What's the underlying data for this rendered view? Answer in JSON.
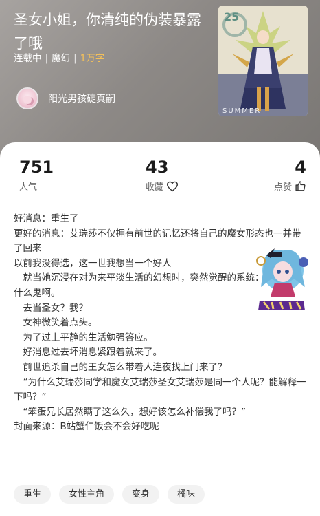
{
  "book": {
    "title": "圣女小姐，你清纯的伪装暴露了哦",
    "status": "连载中",
    "genre": "魔幻",
    "word_count": "1万字",
    "author": "阳光男孩碇真嗣"
  },
  "stats": {
    "popularity": {
      "value": "751",
      "label": "人气"
    },
    "favorites": {
      "value": "43",
      "label": "收藏"
    },
    "likes": {
      "value": "4",
      "label": "点赞"
    }
  },
  "synopsis": {
    "lines": [
      "好消息：重生了",
      "更好的消息：艾瑞莎不仅拥有前世的记忆还将自己的魔女形态也一并带了回来",
      "以前我没得选，这一世我想当一个好人",
      "就当她沉浸在对为来平淡生活的幻想时，突然觉醒的系统：",
      "什么鬼啊。",
      "去当圣女？我？",
      "女神微笑着点头。",
      "为了过上平静的生活勉强答应。",
      "好消息过去坏消息紧跟着就来了。",
      "前世追杀自己的王女怎么带着人连夜找上门来了？",
      "“为什么艾瑞莎同学和魔女艾瑞莎圣女艾瑞莎是同一个人呢？能解释一下吗？”",
      "“笨蛋兄长居然瞒了这么久，想好该怎么补偿我了吗？”",
      "封面来源：B站蟹仁饭会不会好吃呢"
    ]
  },
  "tags": [
    "重生",
    "女性主角",
    "变身",
    "橘味"
  ],
  "icons": {
    "favorite": "heart-icon",
    "like": "thumbs-up-icon"
  },
  "colors": {
    "word_count_accent": "#f3c05a",
    "hero_background": "#8d8986"
  }
}
